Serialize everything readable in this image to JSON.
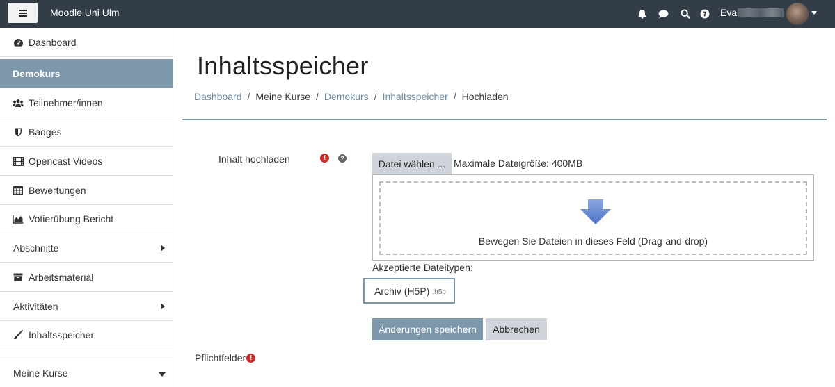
{
  "navbar": {
    "site_name": "Moodle Uni Ulm",
    "user_name": "Eva",
    "icons": [
      "bell-icon",
      "comment-icon",
      "search-icon",
      "question-circle-icon"
    ]
  },
  "sidebar": {
    "items": [
      {
        "label": "Dashboard",
        "icon": "dashboard-icon"
      },
      {
        "label": "Demokurs",
        "icon": "",
        "active": true
      },
      {
        "label": "Teilnehmer/innen",
        "icon": "users-icon"
      },
      {
        "label": "Badges",
        "icon": "shield-icon"
      },
      {
        "label": "Opencast Videos",
        "icon": "film-icon"
      },
      {
        "label": "Bewertungen",
        "icon": "table-icon"
      },
      {
        "label": "Votierübung Bericht",
        "icon": "area-chart-icon"
      },
      {
        "label": "Abschnitte",
        "icon": "",
        "expandable": true
      },
      {
        "label": "Arbeitsmaterial",
        "icon": "archive-icon"
      },
      {
        "label": "Aktivitäten",
        "icon": "",
        "expandable": true
      },
      {
        "label": "Inhaltsspeicher",
        "icon": "paintbrush-icon"
      },
      {
        "label": "Meine Kurse",
        "icon": "",
        "collapsible": true
      }
    ]
  },
  "main": {
    "title": "Inhaltsspeicher",
    "breadcrumb": [
      {
        "label": "Dashboard",
        "link": true
      },
      {
        "label": "Meine Kurse",
        "link": false
      },
      {
        "label": "Demokurs",
        "link": true
      },
      {
        "label": "Inhaltsspeicher",
        "link": true
      },
      {
        "label": "Hochladen",
        "link": false
      }
    ],
    "breadcrumb_separator": "/",
    "form": {
      "field_label": "Inhalt hochladen",
      "required_symbol": "!",
      "help_symbol": "?",
      "choose_button": "Datei wählen ...",
      "max_size": "Maximale Dateigröße: 400MB",
      "drop_text": "Bewegen Sie Dateien in dieses Feld (Drag-and-drop)",
      "accepted_label": "Akzeptierte Dateitypen:",
      "accepted_type": "Archiv (H5P)",
      "accepted_ext": ".h5p",
      "save_button": "Änderungen speichern",
      "cancel_button": "Abbrechen",
      "required_note": "Pflichtfelder"
    }
  },
  "colors": {
    "navbar_bg": "#333d48",
    "accent": "#7d98ab",
    "link": "#6f8ba0",
    "required": "#c9302c",
    "button_secondary": "#ced4da"
  }
}
